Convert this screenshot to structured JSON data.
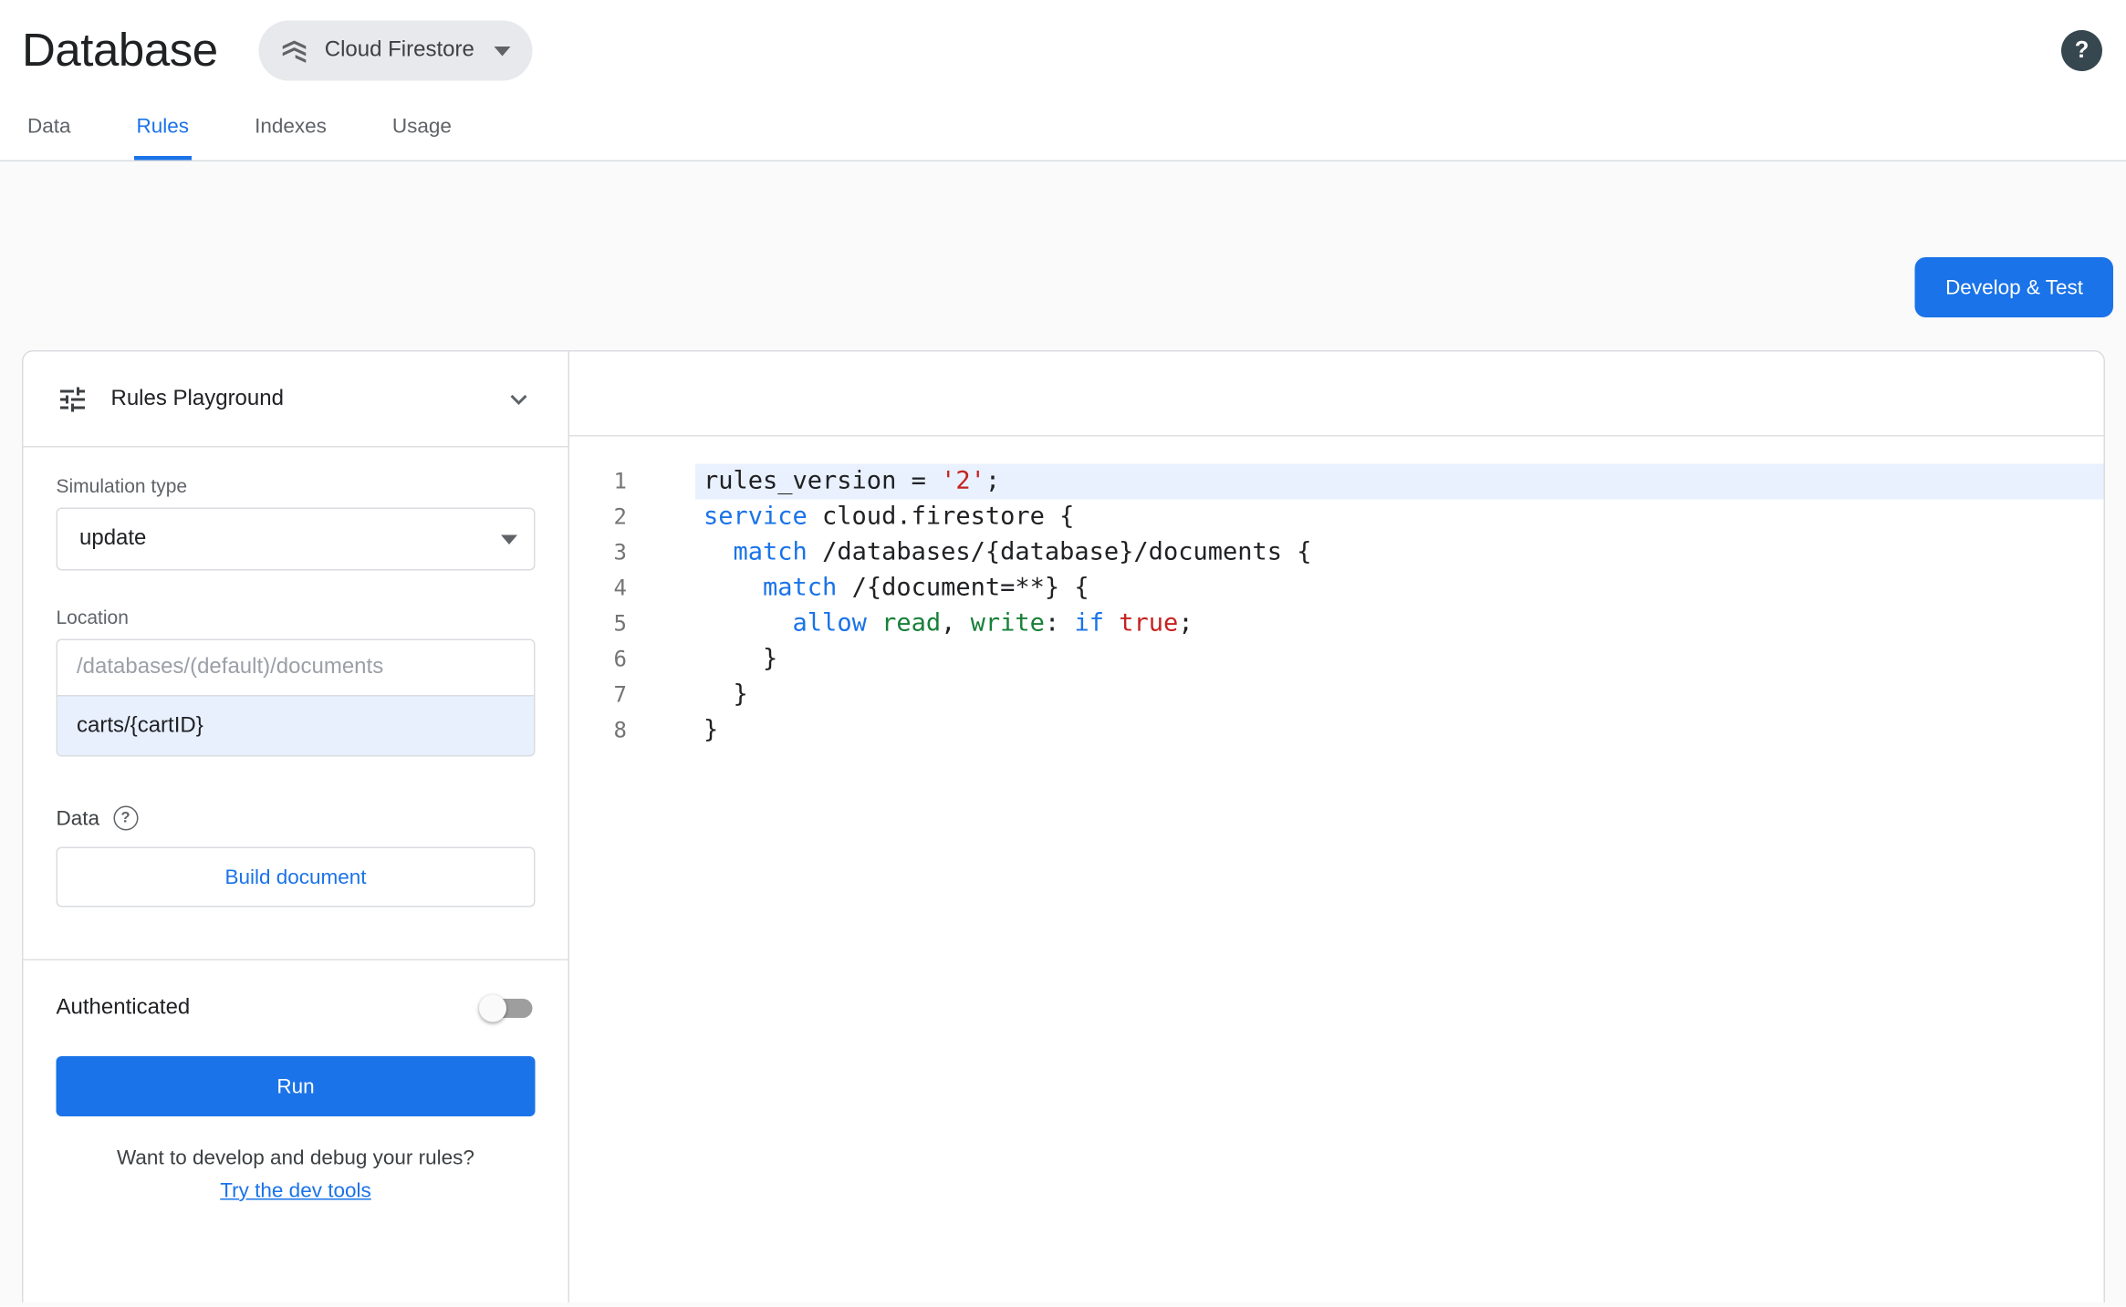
{
  "header": {
    "title": "Database",
    "product_selector": {
      "label": "Cloud Firestore"
    },
    "help_glyph": "?"
  },
  "tabs": [
    {
      "label": "Data",
      "active": false
    },
    {
      "label": "Rules",
      "active": true
    },
    {
      "label": "Indexes",
      "active": false
    },
    {
      "label": "Usage",
      "active": false
    }
  ],
  "actions": {
    "develop_test": "Develop & Test"
  },
  "playground": {
    "title": "Rules Playground",
    "simulation_type_label": "Simulation type",
    "simulation_type_value": "update",
    "location_label": "Location",
    "location_prefix_placeholder": "/databases/(default)/documents",
    "location_value": "carts/{cartID}",
    "data_label": "Data",
    "data_help_glyph": "?",
    "build_document_button": "Build document",
    "authenticated_label": "Authenticated",
    "authenticated_on": false,
    "run_button": "Run",
    "dev_tools_question": "Want to develop and debug your rules?",
    "dev_tools_link": "Try the dev tools"
  },
  "editor": {
    "lines": [
      {
        "number": 1,
        "highlighted": true,
        "segments": [
          {
            "t": "rules_version = ",
            "c": "plain"
          },
          {
            "t": "'2'",
            "c": "string"
          },
          {
            "t": ";",
            "c": "plain"
          }
        ]
      },
      {
        "number": 2,
        "highlighted": false,
        "segments": [
          {
            "t": "service",
            "c": "keyword"
          },
          {
            "t": " cloud.firestore {",
            "c": "plain"
          }
        ]
      },
      {
        "number": 3,
        "highlighted": false,
        "segments": [
          {
            "t": "  ",
            "c": "plain"
          },
          {
            "t": "match",
            "c": "keyword"
          },
          {
            "t": " /databases/{database}/documents {",
            "c": "plain"
          }
        ]
      },
      {
        "number": 4,
        "highlighted": false,
        "segments": [
          {
            "t": "    ",
            "c": "plain"
          },
          {
            "t": "match",
            "c": "keyword"
          },
          {
            "t": " /{document=**} {",
            "c": "plain"
          }
        ]
      },
      {
        "number": 5,
        "highlighted": false,
        "segments": [
          {
            "t": "      ",
            "c": "plain"
          },
          {
            "t": "allow",
            "c": "keyword"
          },
          {
            "t": " ",
            "c": "plain"
          },
          {
            "t": "read",
            "c": "perm"
          },
          {
            "t": ", ",
            "c": "plain"
          },
          {
            "t": "write",
            "c": "perm"
          },
          {
            "t": ": ",
            "c": "plain"
          },
          {
            "t": "if",
            "c": "keyword"
          },
          {
            "t": " ",
            "c": "plain"
          },
          {
            "t": "true",
            "c": "bool"
          },
          {
            "t": ";",
            "c": "plain"
          }
        ]
      },
      {
        "number": 6,
        "highlighted": false,
        "segments": [
          {
            "t": "    }",
            "c": "plain"
          }
        ]
      },
      {
        "number": 7,
        "highlighted": false,
        "segments": [
          {
            "t": "  }",
            "c": "plain"
          }
        ]
      },
      {
        "number": 8,
        "highlighted": false,
        "segments": [
          {
            "t": "}",
            "c": "plain"
          }
        ]
      }
    ]
  },
  "colors": {
    "accent": "#1a73e8",
    "active_line": "#e9f1fe",
    "keyword": "#1a73e8",
    "string": "#c5221f",
    "permission": "#188038",
    "chip_bg": "#e7e9ec"
  }
}
